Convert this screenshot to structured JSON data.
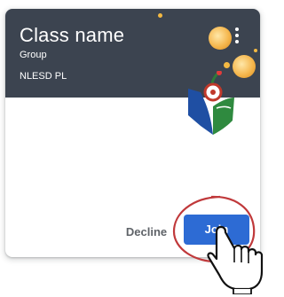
{
  "card": {
    "class_name": "Class name",
    "section": "Group",
    "owner": "NLESD PL"
  },
  "actions": {
    "decline_label": "Decline",
    "join_label": "Join"
  },
  "colors": {
    "header_bg": "#3c4450",
    "join_bg": "#2d6bd4",
    "highlight_ring": "#c0393b",
    "decoration_gold": "#f4b942"
  },
  "icons": [
    "more-vert-icon",
    "school-logo-icon",
    "pointer-hand-icon"
  ]
}
